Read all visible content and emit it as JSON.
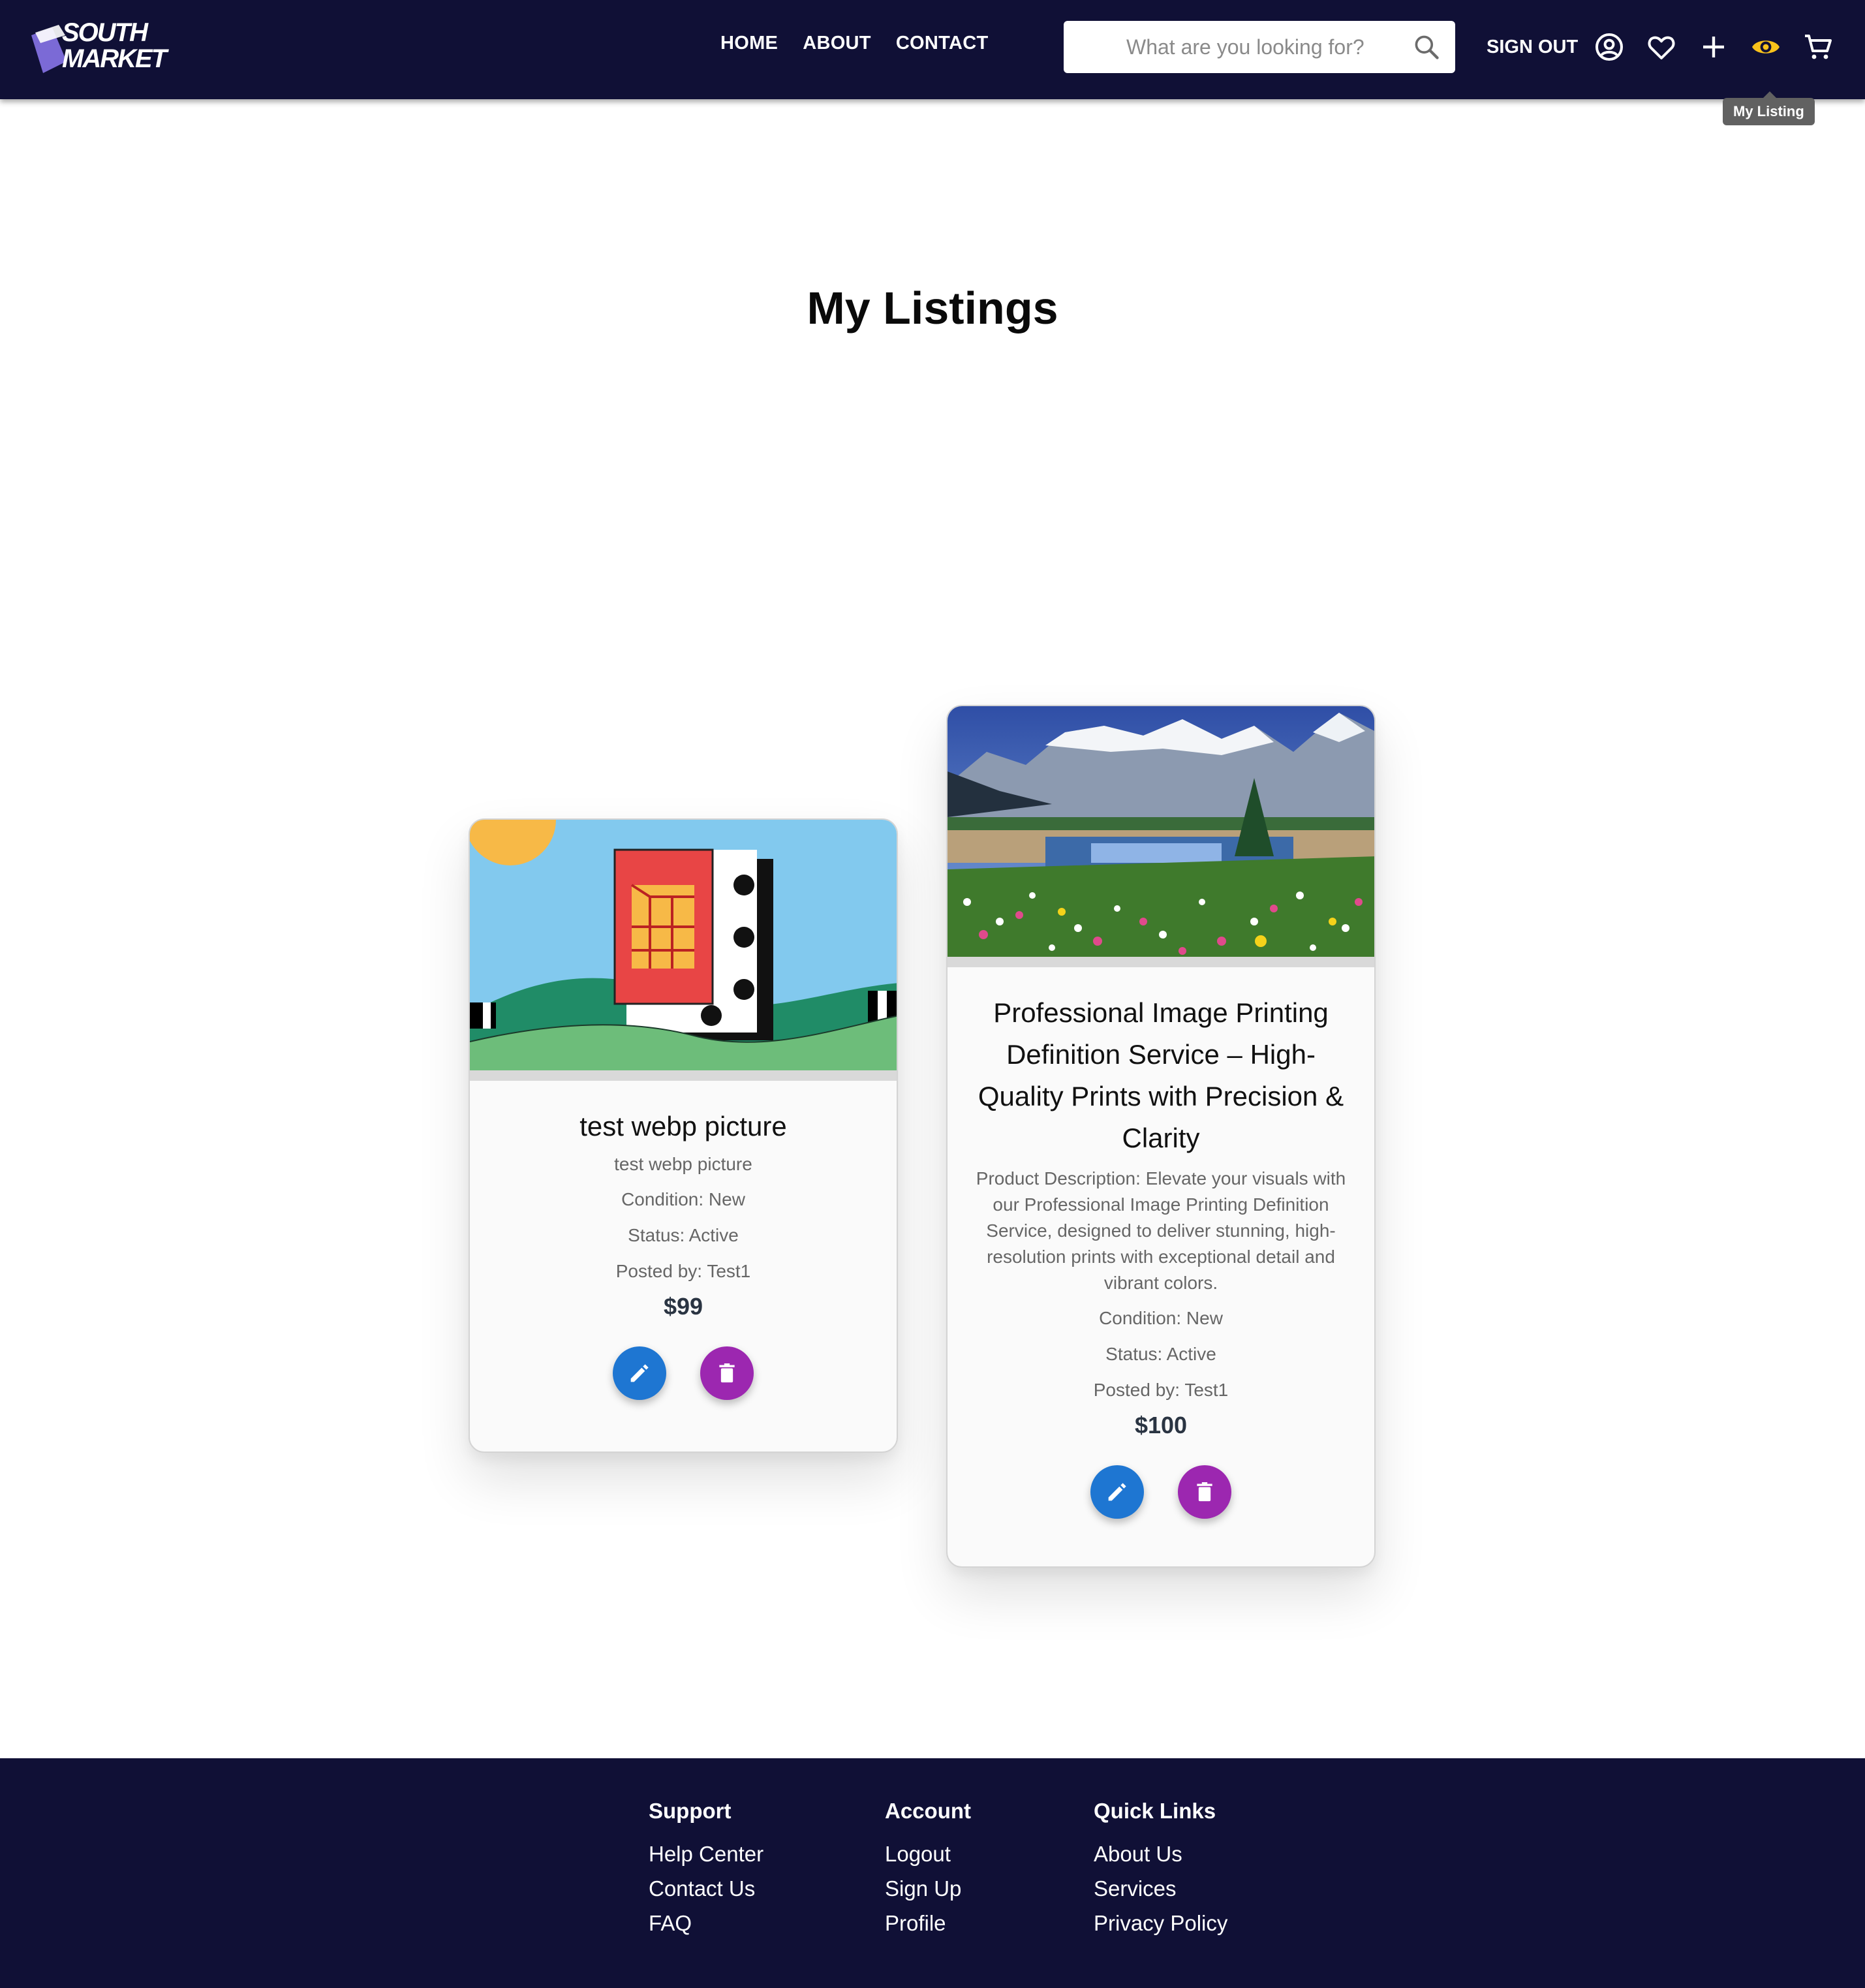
{
  "header": {
    "logo_text_line1": "SOUTH",
    "logo_text_line2": "MARKET",
    "nav": [
      "HOME",
      "ABOUT",
      "CONTACT"
    ],
    "search_placeholder": "What are you looking for?",
    "sign_out": "SIGN OUT",
    "tooltip": "My Listing",
    "active_icon_color": "#f9c21b"
  },
  "main": {
    "title": "My Listings",
    "listings": [
      {
        "title": "test webp picture",
        "description": "test webp picture",
        "condition": "Condition: New",
        "status": "Status: Active",
        "posted_by": "Posted by: Test1",
        "price": "$99"
      },
      {
        "title": "Professional Image Printing Definition Service – High-Quality Prints with Precision & Clarity",
        "description": "Product Description: Elevate your visuals with our Professional Image Printing Definition Service, designed to deliver stunning, high-resolution prints with exceptional detail and vibrant colors.",
        "condition": "Condition: New",
        "status": "Status: Active",
        "posted_by": "Posted by: Test1",
        "price": "$100"
      }
    ],
    "edit_color": "#1e76d2",
    "delete_color": "#9c27b0"
  },
  "footer": {
    "support": {
      "heading": "Support",
      "links": [
        "Help Center",
        "Contact Us",
        "FAQ"
      ]
    },
    "account": {
      "heading": "Account",
      "links": [
        "Logout",
        "Sign Up",
        "Profile"
      ]
    },
    "quick": {
      "heading": "Quick Links",
      "links": [
        "About Us",
        "Services",
        "Privacy Policy"
      ]
    }
  }
}
